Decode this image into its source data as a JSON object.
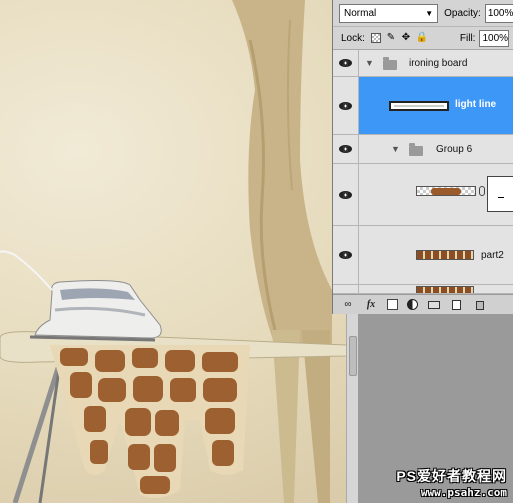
{
  "layers_panel": {
    "blend_mode": "Normal",
    "opacity_label": "Opacity:",
    "opacity_value": "100%",
    "lock_label": "Lock:",
    "fill_label": "Fill:",
    "fill_value": "100%",
    "layers": [
      {
        "name": "ironing board",
        "kind": "group",
        "visible": true,
        "expanded": true
      },
      {
        "name": "light line",
        "kind": "layer",
        "visible": true,
        "selected": true
      },
      {
        "name": "Group 6",
        "kind": "group",
        "visible": true,
        "expanded": true
      },
      {
        "name": "",
        "kind": "masked-layer",
        "visible": true
      },
      {
        "name": "part2",
        "kind": "layer",
        "visible": true
      },
      {
        "name": "",
        "kind": "layer",
        "visible": true
      }
    ],
    "footer_icons": [
      "link-icon",
      "fx-icon",
      "mask-icon",
      "adjustment-icon",
      "folder-icon",
      "new-layer-icon",
      "trash-icon"
    ],
    "footer_labels": {
      "link": "∞",
      "fx": "fx"
    }
  },
  "watermark": {
    "line1": "PS爱好者教程网",
    "line2": "www.psahz.com"
  },
  "colors": {
    "selected_layer": "#3d97f7",
    "panel_bg": "#d4d4d4",
    "canvas_bg": "#e6dbbd"
  }
}
